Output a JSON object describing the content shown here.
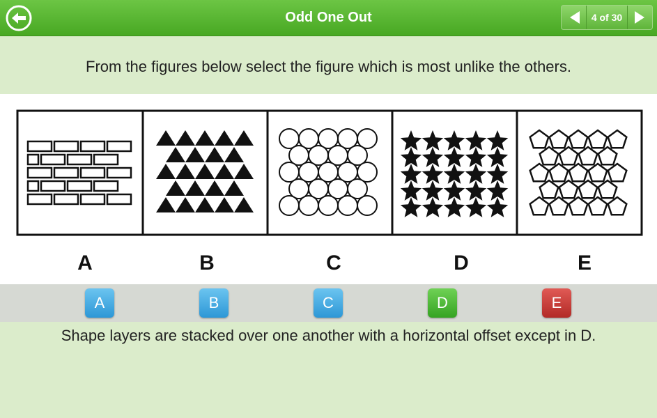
{
  "header": {
    "title": "Odd One Out",
    "pager": "4 of 30",
    "back_icon": "back-arrow-icon",
    "prev_icon": "triangle-left-icon",
    "next_icon": "triangle-right-icon"
  },
  "question": "From the figures below select the figure which is most unlike the others.",
  "figures": [
    {
      "label": "A",
      "pattern": "bricks"
    },
    {
      "label": "B",
      "pattern": "triangles"
    },
    {
      "label": "C",
      "pattern": "circles"
    },
    {
      "label": "D",
      "pattern": "stars"
    },
    {
      "label": "E",
      "pattern": "pentagons"
    }
  ],
  "answers": [
    {
      "label": "A",
      "color": "#2d97d6"
    },
    {
      "label": "B",
      "color": "#2d97d6"
    },
    {
      "label": "C",
      "color": "#2d97d6"
    },
    {
      "label": "D",
      "color": "#35a322"
    },
    {
      "label": "E",
      "color": "#b22a26"
    }
  ],
  "explanation": "Shape layers are stacked over one another with a horizontal offset except in D.",
  "colors": {
    "header_green": "#48a823",
    "band": "#dbeccb"
  }
}
